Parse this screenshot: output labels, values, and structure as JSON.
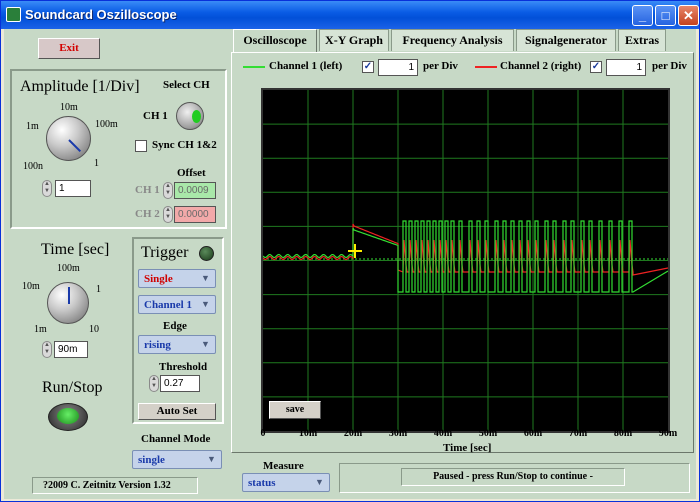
{
  "window": {
    "title": "Soundcard Oszilloscope"
  },
  "left": {
    "exit_label": "Exit",
    "amplitude": {
      "title": "Amplitude [1/Div]",
      "scale": [
        "1m",
        "10m",
        "100m",
        "1",
        "100n"
      ],
      "value": "1"
    },
    "select_ch": {
      "label": "Select CH",
      "ch_label": "CH 1",
      "sync_label": "Sync CH 1&2",
      "sync_checked": false
    },
    "offset": {
      "label": "Offset",
      "ch1_label": "CH 1",
      "ch1_value": "0.0009",
      "ch2_label": "CH 2",
      "ch2_value": "0.0000"
    },
    "time": {
      "title": "Time [sec]",
      "scale": [
        "10m",
        "100m",
        "1",
        "1m",
        "10"
      ],
      "value": "90m"
    },
    "run_stop_label": "Run/Stop",
    "trigger": {
      "title": "Trigger",
      "mode": "Single",
      "source": "Channel 1",
      "edge_label": "Edge",
      "edge": "rising",
      "threshold_label": "Threshold",
      "threshold": "0.27",
      "autoset_label": "Auto Set"
    },
    "channel_mode": {
      "label": "Channel Mode",
      "value": "single"
    },
    "version": "?2009   C. Zeitnitz Version 1.32"
  },
  "tabs": [
    "Oscilloscope",
    "X-Y Graph",
    "Frequency Analysis",
    "Signalgenerator",
    "Extras"
  ],
  "channels": {
    "ch1": {
      "name": "Channel 1 (left)",
      "enabled": true,
      "per_div": "1",
      "per_div_label": "per Div",
      "color": "#33dd33"
    },
    "ch2": {
      "name": "Channel 2 (right)",
      "enabled": true,
      "per_div": "1",
      "per_div_label": "per Div",
      "color": "#ee2222"
    }
  },
  "plot": {
    "x_ticks": [
      "0",
      "10m",
      "20m",
      "30m",
      "40m",
      "50m",
      "60m",
      "70m",
      "80m",
      "90m"
    ],
    "x_label": "Time [sec]",
    "save_label": "save"
  },
  "measure": {
    "label": "Measure",
    "value": "status"
  },
  "status_text": "Paused - press Run/Stop to continue -"
}
